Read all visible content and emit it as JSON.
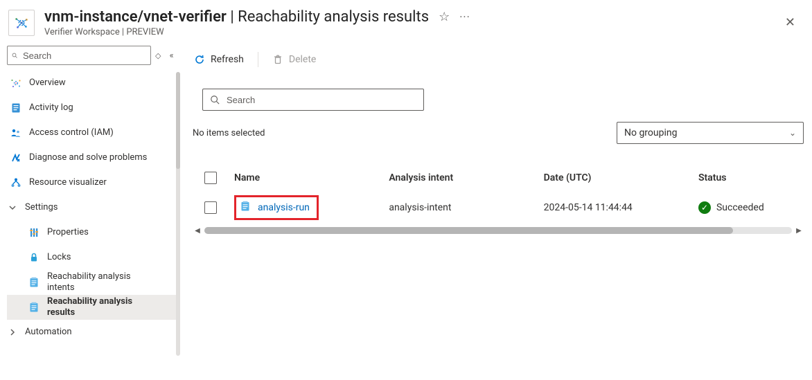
{
  "header": {
    "resource_path": "vnm-instance/vnet-verifier",
    "page_title": "Reachability analysis results",
    "subtitle": "Verifier Workspace | PREVIEW"
  },
  "sidebar": {
    "search_placeholder": "Search",
    "items": {
      "overview": "Overview",
      "activity": "Activity log",
      "iam": "Access control (IAM)",
      "diagnose": "Diagnose and solve problems",
      "visualizer": "Resource visualizer",
      "settings": "Settings",
      "properties": "Properties",
      "locks": "Locks",
      "intents": "Reachability analysis intents",
      "results": "Reachability analysis results",
      "automation": "Automation"
    }
  },
  "toolbar": {
    "refresh": "Refresh",
    "delete": "Delete"
  },
  "content": {
    "search_placeholder": "Search",
    "no_selection": "No items selected",
    "grouping_selected": "No grouping"
  },
  "grid": {
    "headers": {
      "name": "Name",
      "intent": "Analysis intent",
      "date": "Date (UTC)",
      "status": "Status"
    },
    "rows": [
      {
        "name": "analysis-run",
        "intent": "analysis-intent",
        "date": "2024-05-14 11:44:44",
        "status": "Succeeded"
      }
    ]
  }
}
